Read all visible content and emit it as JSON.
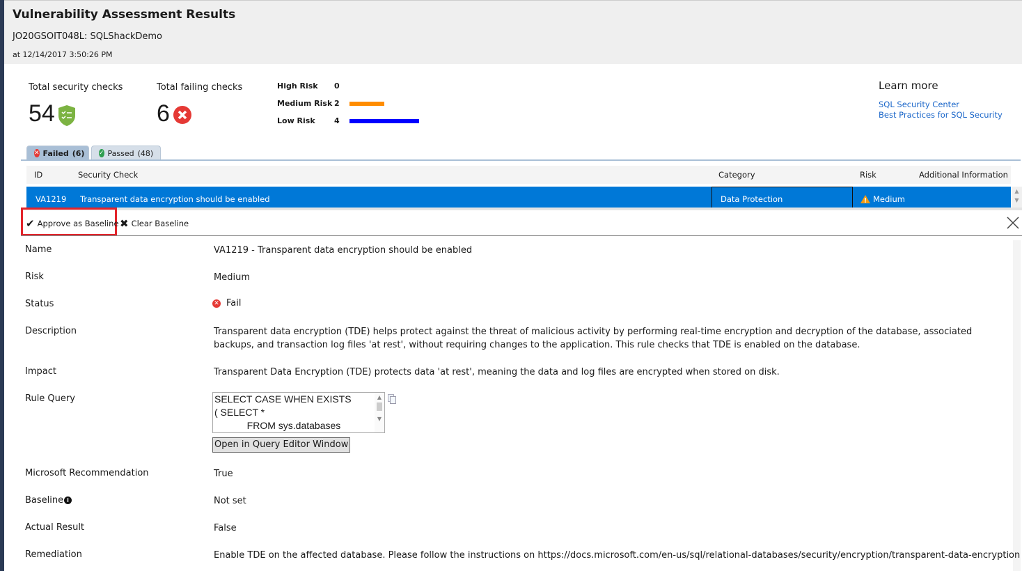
{
  "header": {
    "title": "Vulnerability Assessment Results",
    "server": "JO20GSOIT048L: SQLShackDemo",
    "timestamp": "at 12/14/2017 3:50:26 PM"
  },
  "summary": {
    "total_label": "Total security checks",
    "total_value": "54",
    "failing_label": "Total failing checks",
    "failing_value": "6"
  },
  "risks": [
    {
      "label": "High Risk",
      "count": "0",
      "value": 0,
      "color": "#ff0000"
    },
    {
      "label": "Medium Risk",
      "count": "2",
      "value": 2,
      "color": "#ff8c00"
    },
    {
      "label": "Low Risk",
      "count": "4",
      "value": 4,
      "color": "#0000ff"
    }
  ],
  "learn_more": {
    "title": "Learn more",
    "links": [
      "SQL Security Center",
      "Best Practices for SQL Security"
    ]
  },
  "tabs": [
    {
      "label": "Failed",
      "count": "(6)"
    },
    {
      "label": "Passed",
      "count": "(48)"
    }
  ],
  "grid": {
    "columns": [
      "ID",
      "Security Check",
      "Category",
      "Risk",
      "Additional Information"
    ],
    "row": {
      "id": "VA1219",
      "check": "Transparent data encryption should be enabled",
      "category": "Data Protection",
      "risk": "Medium",
      "info": ""
    }
  },
  "toolbar": {
    "approve": "Approve as Baseline",
    "clear": "Clear Baseline"
  },
  "details": {
    "name_label": "Name",
    "name": "VA1219 - Transparent data encryption should be enabled",
    "risk_label": "Risk",
    "risk": "Medium",
    "status_label": "Status",
    "status": "Fail",
    "description_label": "Description",
    "description": "Transparent data encryption (TDE) helps protect against the threat of malicious activity by performing real-time encryption and decryption of the database, associated backups, and transaction log files 'at rest', without requiring changes to the application. This rule checks that TDE is enabled on the database.",
    "impact_label": "Impact",
    "impact": "Transparent Data Encryption (TDE) protects data 'at rest', meaning the data and log files are encrypted when stored on disk.",
    "query_label": "Rule Query",
    "query_lines": [
      "SELECT CASE WHEN EXISTS",
      "( SELECT *",
      "            FROM sys.databases"
    ],
    "open_query": "Open in Query Editor Window",
    "recommendation_label": "Microsoft Recommendation",
    "recommendation": "True",
    "baseline_label": "Baseline",
    "baseline": "Not set",
    "actual_label": "Actual Result",
    "actual": "False",
    "remediation_label": "Remediation",
    "remediation": "Enable TDE on the affected database. Please follow the instructions on https://docs.microsoft.com/en-us/sql/relational-databases/security/encryption/transparent-data-encryption"
  }
}
